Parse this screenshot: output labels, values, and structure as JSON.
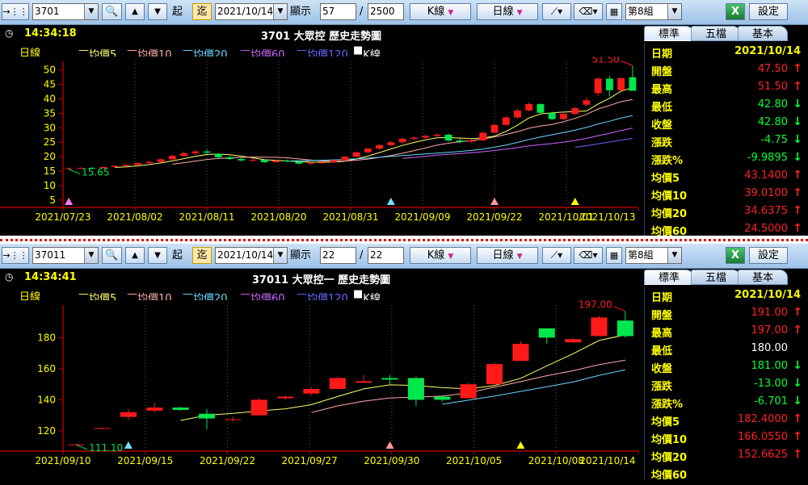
{
  "colors": {
    "up": "#ff1a1a",
    "down": "#00e64d",
    "ma5": "#ffff66",
    "ma10": "#ffaaaa",
    "ma20": "#66d9ff",
    "ma60": "#cc66ff",
    "ma120": "#6666ff",
    "axis": "#d00000",
    "tick": "#ffff00",
    "info_up": "#ff2020",
    "info_down": "#00ff33"
  },
  "panels": [
    {
      "toolbar": {
        "stock_code": "3701",
        "start_btn": "起",
        "end_btn": "迄",
        "date": "2021/10/14",
        "display_label": "顯示",
        "display_count": "57",
        "total": "2500",
        "kline_btn": "K線",
        "period_btn": "日線",
        "group_select": "第8組",
        "settings_btn": "設定"
      },
      "header": {
        "time": "14:34:18",
        "title": "3701 大眾控  歷史走勢圖"
      },
      "tabs": [
        "標準",
        "五檔",
        "基本"
      ],
      "legend": {
        "period": "日線",
        "ma5": "均價5",
        "ma10": "均價10",
        "ma20": "均價20",
        "ma60": "均價60",
        "ma120": "均價120",
        "k": "K線"
      },
      "info": [
        {
          "label": "日期",
          "value": "2021/10/14",
          "dir": "none"
        },
        {
          "label": "開盤",
          "value": "47.50",
          "dir": "up"
        },
        {
          "label": "最高",
          "value": "51.50",
          "dir": "up"
        },
        {
          "label": "最低",
          "value": "42.80",
          "dir": "down"
        },
        {
          "label": "收盤",
          "value": "42.80",
          "dir": "down"
        },
        {
          "label": "漲跌",
          "value": "-4.75",
          "dir": "down"
        },
        {
          "label": "漲跌%",
          "value": "-9.9895",
          "dir": "down"
        },
        {
          "label": "均價5",
          "value": "43.1400",
          "dir": "up"
        },
        {
          "label": "均價10",
          "value": "39.0100",
          "dir": "up"
        },
        {
          "label": "均價20",
          "value": "34.6375",
          "dir": "up"
        },
        {
          "label": "均價60",
          "value": "24.5000",
          "dir": "up"
        }
      ],
      "chart_data": {
        "type": "candlestick",
        "x_labels": [
          "2021/07/23",
          "2021/08/02",
          "2021/08/11",
          "2021/08/20",
          "2021/08/31",
          "2021/09/09",
          "2021/09/22",
          "2021/10/01",
          "2021/10/13"
        ],
        "y_ticks": [
          5,
          10,
          15,
          20,
          25,
          30,
          35,
          40,
          45,
          50
        ],
        "ylim": [
          3,
          53
        ],
        "labels": {
          "high": "51.50",
          "low": "15.65"
        },
        "markers": [
          {
            "i": 0,
            "color": "#ff77ff"
          },
          {
            "i": 28,
            "color": "#77ddff"
          },
          {
            "i": 37,
            "color": "#ff9999"
          },
          {
            "i": 44,
            "color": "#ffff00"
          }
        ],
        "candles": [
          [
            15.8,
            16.2,
            15.65,
            16.0
          ],
          [
            16.0,
            16.3,
            15.8,
            16.1
          ],
          [
            16.1,
            16.4,
            15.9,
            16.0
          ],
          [
            16.0,
            16.6,
            15.9,
            16.4
          ],
          [
            16.4,
            17.0,
            16.2,
            16.8
          ],
          [
            16.8,
            17.4,
            16.6,
            17.2
          ],
          [
            17.2,
            18.0,
            17.0,
            17.8
          ],
          [
            17.8,
            18.6,
            17.5,
            18.2
          ],
          [
            18.2,
            19.4,
            18.0,
            19.1
          ],
          [
            19.1,
            20.6,
            18.8,
            20.3
          ],
          [
            20.3,
            21.8,
            20.0,
            21.2
          ],
          [
            21.2,
            22.3,
            20.6,
            21.8
          ],
          [
            21.8,
            22.5,
            21.0,
            21.4
          ],
          [
            21.0,
            21.3,
            19.6,
            19.8
          ],
          [
            19.8,
            20.2,
            18.9,
            19.2
          ],
          [
            19.2,
            19.6,
            18.4,
            18.7
          ],
          [
            18.7,
            19.3,
            18.2,
            18.9
          ],
          [
            18.9,
            19.1,
            17.8,
            18.1
          ],
          [
            18.1,
            18.9,
            17.9,
            18.6
          ],
          [
            18.6,
            19.0,
            18.1,
            18.3
          ],
          [
            18.3,
            18.6,
            17.2,
            17.6
          ],
          [
            17.6,
            18.2,
            17.1,
            17.9
          ],
          [
            17.9,
            18.4,
            17.5,
            18.0
          ],
          [
            18.0,
            19.0,
            17.8,
            18.8
          ],
          [
            18.8,
            20.2,
            18.5,
            20.0
          ],
          [
            20.0,
            21.8,
            19.8,
            21.5
          ],
          [
            21.5,
            23.0,
            21.2,
            22.8
          ],
          [
            22.8,
            24.4,
            22.4,
            24.0
          ],
          [
            24.0,
            25.4,
            23.6,
            25.0
          ],
          [
            25.0,
            26.6,
            24.6,
            26.2
          ],
          [
            26.2,
            27.0,
            25.6,
            26.6
          ],
          [
            26.6,
            27.5,
            26.2,
            27.2
          ],
          [
            27.2,
            28.0,
            26.8,
            27.6
          ],
          [
            27.6,
            28.0,
            25.2,
            25.6
          ],
          [
            25.6,
            26.2,
            24.6,
            25.2
          ],
          [
            25.2,
            26.0,
            24.8,
            25.6
          ],
          [
            25.6,
            28.6,
            25.4,
            28.3
          ],
          [
            28.3,
            31.2,
            28.0,
            31.0
          ],
          [
            31.0,
            34.0,
            30.8,
            33.6
          ],
          [
            33.6,
            36.5,
            33.2,
            36.0
          ],
          [
            36.0,
            38.8,
            35.6,
            38.2
          ],
          [
            38.2,
            38.5,
            34.8,
            35.2
          ],
          [
            35.2,
            35.6,
            32.6,
            33.0
          ],
          [
            33.0,
            35.2,
            32.8,
            34.8
          ],
          [
            34.8,
            37.2,
            34.5,
            36.8
          ],
          [
            38.0,
            40.5,
            37.5,
            39.5
          ],
          [
            42.0,
            47.5,
            41.0,
            47.0
          ],
          [
            47.0,
            48.0,
            40.8,
            43.0
          ],
          [
            43.0,
            47.5,
            42.8,
            47.2
          ],
          [
            47.5,
            51.5,
            42.8,
            42.8
          ]
        ]
      }
    },
    {
      "toolbar": {
        "stock_code": "37011",
        "start_btn": "起",
        "end_btn": "迄",
        "date": "2021/10/14",
        "display_label": "顯示",
        "display_count": "22",
        "total": "22",
        "kline_btn": "K線",
        "period_btn": "日線",
        "group_select": "第8組",
        "settings_btn": "設定"
      },
      "header": {
        "time": "14:34:41",
        "title": "37011 大眾控一  歷史走勢圖"
      },
      "tabs": [
        "標準",
        "五檔",
        "基本"
      ],
      "legend": {
        "period": "日線",
        "ma5": "均價5",
        "ma10": "均價10",
        "ma20": "均價20",
        "ma60": "均價60",
        "ma120": "均價120",
        "k": "K線"
      },
      "info": [
        {
          "label": "日期",
          "value": "2021/10/14",
          "dir": "none"
        },
        {
          "label": "開盤",
          "value": "191.00",
          "dir": "up"
        },
        {
          "label": "最高",
          "value": "197.00",
          "dir": "up"
        },
        {
          "label": "最低",
          "value": "180.00",
          "dir": "none"
        },
        {
          "label": "收盤",
          "value": "181.00",
          "dir": "down"
        },
        {
          "label": "漲跌",
          "value": "-13.00",
          "dir": "down"
        },
        {
          "label": "漲跌%",
          "value": "-6.701",
          "dir": "down"
        },
        {
          "label": "均價5",
          "value": "182.4000",
          "dir": "up"
        },
        {
          "label": "均價10",
          "value": "166.0550",
          "dir": "up"
        },
        {
          "label": "均價20",
          "value": "152.6625",
          "dir": "up"
        },
        {
          "label": "均價60",
          "value": "",
          "dir": "none"
        }
      ],
      "chart_data": {
        "type": "candlestick",
        "x_labels": [
          "2021/09/10",
          "2021/09/15",
          "2021/09/22",
          "2021/09/27",
          "2021/09/30",
          "2021/10/05",
          "2021/10/08",
          "2021/10/14"
        ],
        "y_ticks": [
          120,
          140,
          160,
          180
        ],
        "ylim": [
          108,
          201
        ],
        "labels": {
          "high": "197.00",
          "low": "111.10"
        },
        "markers": [
          {
            "i": 2,
            "color": "#77ddff"
          },
          {
            "i": 12,
            "color": "#ff9999"
          },
          {
            "i": 17,
            "color": "#ffff00"
          }
        ],
        "candles": [
          [
            111.1,
            111.5,
            111.1,
            111.3
          ],
          [
            121.5,
            122.0,
            121.0,
            121.8
          ],
          [
            129.0,
            134.0,
            127.0,
            132.0
          ],
          [
            133.0,
            138.0,
            132.0,
            135.0
          ],
          [
            135.0,
            135.5,
            133.0,
            133.5
          ],
          [
            131.0,
            134.0,
            121.0,
            128.0
          ],
          [
            127.0,
            129.0,
            126.0,
            127.5
          ],
          [
            130.0,
            141.0,
            130.0,
            140.0
          ],
          [
            141.0,
            143.0,
            140.0,
            142.0
          ],
          [
            144.0,
            148.0,
            143.0,
            147.0
          ],
          [
            147.0,
            155.0,
            147.0,
            154.0
          ],
          [
            151.0,
            156.0,
            151.0,
            152.0
          ],
          [
            154.0,
            156.0,
            150.0,
            153.0
          ],
          [
            154.0,
            155.0,
            136.0,
            140.0
          ],
          [
            142.0,
            143.0,
            139.0,
            140.0
          ],
          [
            141.0,
            151.0,
            141.0,
            150.0
          ],
          [
            150.0,
            164.0,
            150.0,
            163.0
          ],
          [
            165.0,
            178.0,
            165.0,
            176.0
          ],
          [
            186.0,
            186.0,
            176.0,
            180.0
          ],
          [
            177.0,
            180.0,
            177.0,
            179.0
          ],
          [
            181.0,
            194.0,
            181.0,
            193.0
          ],
          [
            191.0,
            197.0,
            180.0,
            181.0
          ]
        ]
      }
    }
  ]
}
